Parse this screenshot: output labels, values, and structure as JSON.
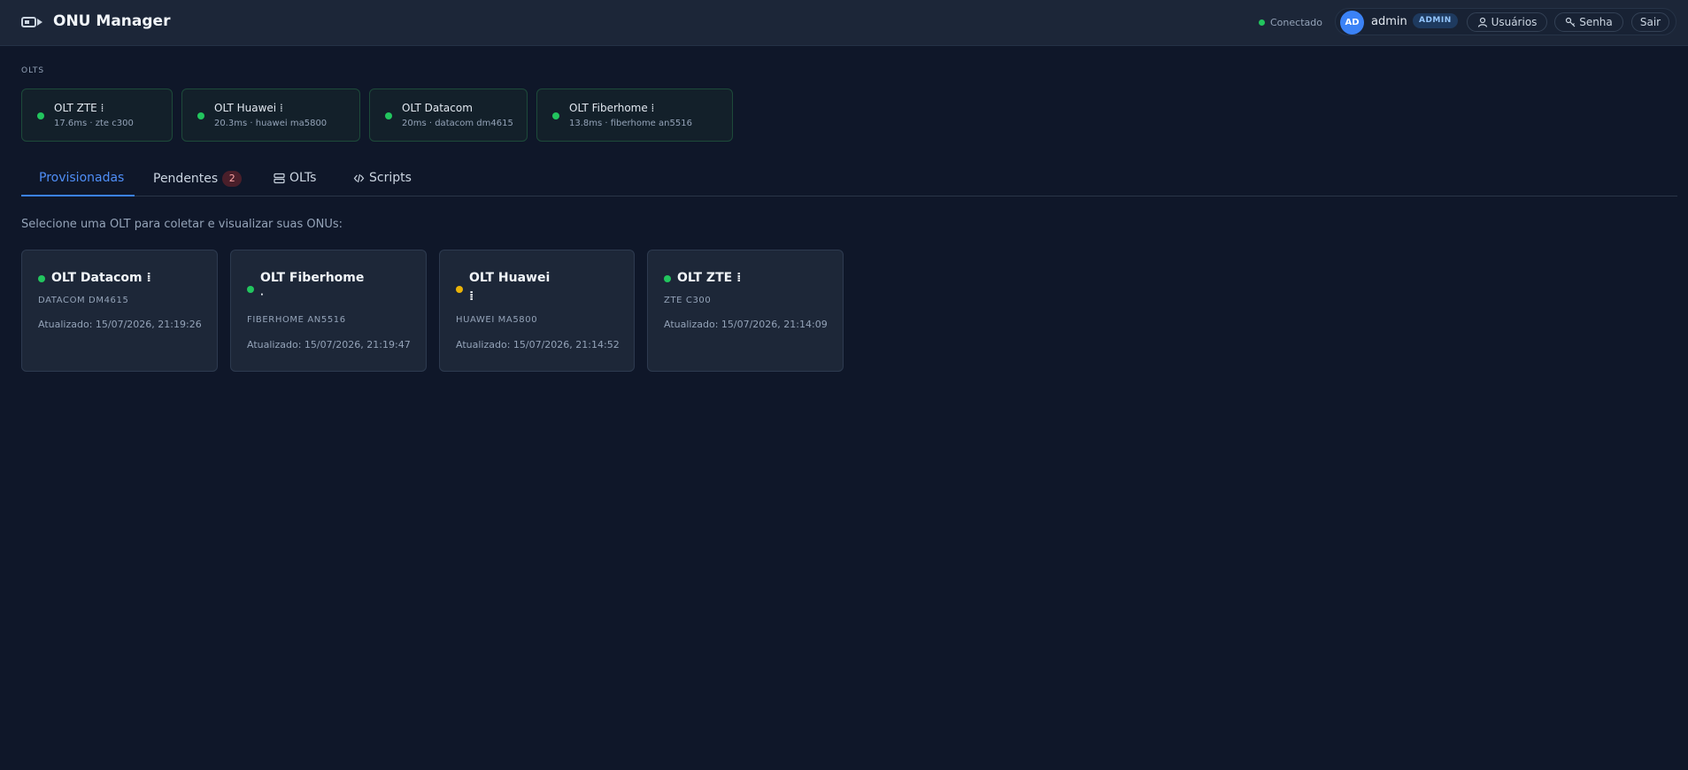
{
  "header": {
    "title": "ONU Manager",
    "logo_icon": "server-link-icon",
    "connection_status": "Conectado",
    "connection_color": "#22c55e",
    "user": {
      "initials": "AD",
      "name": "admin",
      "role": "ADMIN"
    },
    "buttons": {
      "users": "Usuários",
      "password": "Senha",
      "logout": "Sair"
    }
  },
  "olts_section": {
    "label": "OLTS",
    "chips": [
      {
        "name": "OLT ZTE ⁞",
        "meta": "17.6ms · zte c300",
        "status": "online"
      },
      {
        "name": "OLT Huawei ⁞",
        "meta": "20.3ms · huawei ma5800",
        "status": "online"
      },
      {
        "name": "OLT Datacom",
        "meta": "20ms · datacom dm4615",
        "status": "online"
      },
      {
        "name": "OLT Fiberhome ⁞",
        "meta": "13.8ms · fiberhome an5516",
        "status": "online"
      }
    ]
  },
  "tabs": [
    {
      "label": "Provisionadas",
      "active": true
    },
    {
      "label": "Pendentes",
      "badge": "2"
    },
    {
      "label": "OLTs",
      "icon": "server-icon"
    },
    {
      "label": "Scripts",
      "icon": "code-icon"
    }
  ],
  "hint": "Selecione uma OLT para coletar e visualizar suas ONUs:",
  "cards": [
    {
      "title": "OLT Datacom ⁞",
      "model": "DATACOM DM4615",
      "updated": "Atualizado: 15/07/2026, 21:19:26",
      "status_color": "#22c55e"
    },
    {
      "title": "OLT Fiberhome",
      "title2": "·",
      "model": "FIBERHOME AN5516",
      "updated": "Atualizado: 15/07/2026, 21:19:47",
      "status_color": "#22c55e"
    },
    {
      "title": "OLT Huawei",
      "title2": "⁞",
      "model": "HUAWEI MA5800",
      "updated": "Atualizado: 15/07/2026, 21:14:52",
      "status_color": "#eab308"
    },
    {
      "title": "OLT ZTE ⁞",
      "model": "ZTE C300",
      "updated": "Atualizado: 15/07/2026, 21:14:09",
      "status_color": "#22c55e"
    }
  ],
  "colors": {
    "background": "#0f1729",
    "accent": "#3b82f6",
    "online": "#22c55e",
    "warning": "#eab308"
  }
}
